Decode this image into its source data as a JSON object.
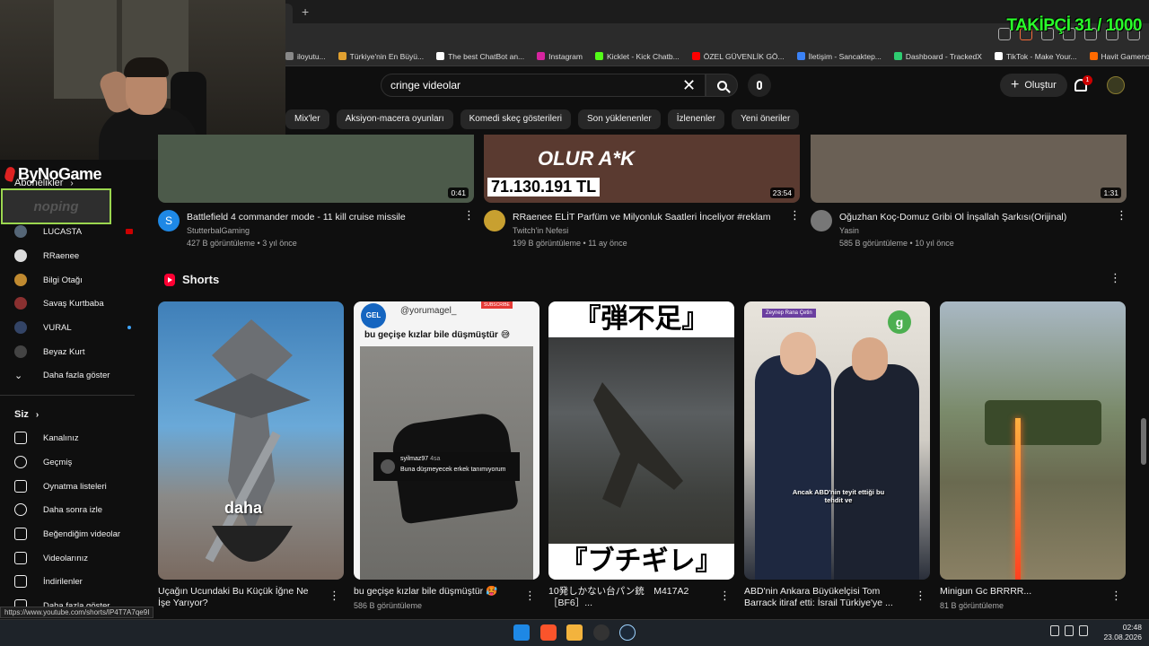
{
  "browser": {
    "new_tab_symbol": "+",
    "bookmarks": [
      {
        "label": "iloyutu...",
        "color": "#888888"
      },
      {
        "label": "Türkiye'nin En Büyü...",
        "color": "#e0a030"
      },
      {
        "label": "The best ChatBot an...",
        "color": "#ffffff"
      },
      {
        "label": "Instagram",
        "color": "#d6249f"
      },
      {
        "label": "Kicklet - Kick Chatb...",
        "color": "#53fc18"
      },
      {
        "label": "ÖZEL GÜVENLİK GÖ...",
        "color": "#ff0000"
      },
      {
        "label": "İletişim - Sancaktep...",
        "color": "#3b82f6"
      },
      {
        "label": "Dashboard - TrackedX",
        "color": "#2ecc71"
      },
      {
        "label": "TikTok - Make Your...",
        "color": "#ffffff"
      },
      {
        "label": "Havit Gamenote GK...",
        "color": "#ff6a00"
      }
    ],
    "status_url": "https://www.youtube.com/shorts/lP4T7A7qe9I"
  },
  "overlay": {
    "follower_counter": "TAKİPÇİ 31 / 1000",
    "brand": "ByNoGame",
    "sponsor": "noping"
  },
  "header": {
    "search_value": "cringe videolar",
    "create_label": "Oluştur",
    "notif_count": "1"
  },
  "chips": [
    "Mix'ler",
    "Aksiyon-macera oyunları",
    "Komedi skeç gösterileri",
    "Son yüklenenler",
    "İzlenenler",
    "Yeni öneriler"
  ],
  "sidebar": {
    "subs_title": "Abonelikler",
    "subscriptions": [
      {
        "label": "LUCASTA",
        "color": "#556677",
        "badge": "live"
      },
      {
        "label": "RRaenee",
        "color": "#dddddd",
        "badge": ""
      },
      {
        "label": "Bilgi Otağı",
        "color": "#c08a30",
        "badge": ""
      },
      {
        "label": "Savaş Kurtbaba",
        "color": "#8a3030",
        "badge": ""
      },
      {
        "label": "VURAL",
        "color": "#334466",
        "badge": "dot"
      },
      {
        "label": "Beyaz Kurt",
        "color": "#444444",
        "badge": ""
      }
    ],
    "show_more": "Daha fazla göster",
    "you_title": "Siz",
    "you_items": [
      {
        "label": "Kanalınız",
        "icon": "channel-icon"
      },
      {
        "label": "Geçmiş",
        "icon": "history-icon"
      },
      {
        "label": "Oynatma listeleri",
        "icon": "playlist-icon"
      },
      {
        "label": "Daha sonra izle",
        "icon": "clock-icon"
      },
      {
        "label": "Beğendiğim videolar",
        "icon": "thumbs-up-icon"
      },
      {
        "label": "Videolarınız",
        "icon": "video-icon"
      },
      {
        "label": "İndirilenler",
        "icon": "download-icon"
      },
      {
        "label": "Daha fazla göster",
        "icon": "chevron-down-icon"
      }
    ]
  },
  "videos": [
    {
      "title": "Battlefield 4 commander mode - 11 kill cruise missile",
      "channel": "StutterbalGaming",
      "stats": "427 B görüntüleme • 3 yıl önce",
      "duration": "0:41",
      "avatar_letter": "S",
      "avatar_color": "#1e88e5",
      "thumb_color": "#4c5a4a"
    },
    {
      "title": "RRaenee ELİT Parfüm ve Milyonluk Saatleri İnceliyor #reklam",
      "channel": "Twitch'in Nefesi",
      "stats": "199 B görüntüleme • 11 ay önce",
      "duration": "23:54",
      "avatar_letter": "",
      "avatar_color": "#c8a030",
      "thumb_color": "#5a3a30",
      "thumb_text_1": "OLUR A*K",
      "thumb_text_2": "71.130.191 TL"
    },
    {
      "title": "Oğuzhan Koç-Domuz Gribi Ol İnşallah Şarkısı(Orijinal)",
      "channel": "Yasin",
      "stats": "585 B görüntüleme • 10 yıl önce",
      "duration": "1:31",
      "avatar_letter": "",
      "avatar_color": "#777777",
      "thumb_color": "#6a6055"
    }
  ],
  "shorts": {
    "title": "Shorts",
    "items": [
      {
        "title": "Uçağın Ucundaki Bu Küçük İğne Ne İşe Yarıyor?",
        "views": "",
        "overlay": "daha"
      },
      {
        "title": "bu geçişe kızlar bile düşmüştür 🥵",
        "views": "586 B görüntüleme",
        "handle": "@yorumagel_",
        "caption": "bu geçişe kızlar bile düşmüştür 😅",
        "comment_user": "syilmaz97",
        "comment_age": "4sa",
        "comment_text": "Buna düşmeyecek erkek tanımıyorum",
        "badge": "SUBSCRIBE",
        "logo_text": "GEL"
      },
      {
        "title": "10発しかない台パン銃　M417A2［BF6］...",
        "views": "",
        "top_text": "『弾不足』",
        "bottom_text": "『ブチギレ』"
      },
      {
        "title": "ABD'nin Ankara Büyükelçisi Tom Barrack itiraf etti: İsrail Türkiye'ye ...",
        "views": "",
        "caption": "Ancak ABD'nin teyit ettiği bu tehdit ve",
        "speaker": "Zeynep Rana Çetin"
      },
      {
        "title": "Minigun Gc BRRRR...",
        "views": "81 B görüntüleme"
      }
    ]
  },
  "taskbar": {
    "time": "02:48",
    "date": "23.08.2026"
  }
}
